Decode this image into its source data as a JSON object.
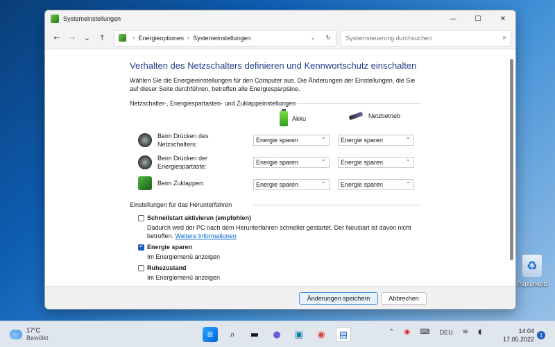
{
  "desktop": {
    "recycle_bin_label": "Papierkorb"
  },
  "window": {
    "title": "Systemeinstellungen",
    "controls": {
      "minimize": "—",
      "maximize": "☐",
      "close": "✕"
    }
  },
  "nav": {
    "back": "←",
    "forward": "→",
    "dropdown": "⌄",
    "up": "↑",
    "breadcrumb": [
      "Energieoptionen",
      "Systemeinstellungen"
    ],
    "breadcrumb_sep": "›",
    "addr_dropdown": "⌄",
    "refresh": "↻",
    "search_placeholder": "Systemsteuerung durchsuchen",
    "search_icon": "⌕"
  },
  "main": {
    "heading": "Verhalten des Netzschalters definieren und Kennwortschutz einschalten",
    "intro": "Wählen Sie die Energieeinstellungen für den Computer aus. Die Änderungen der Einstellungen, die Sie auf dieser Seite durchführen, betreffen alle Energiesparpläne.",
    "power_group_title": "Netzschalter-, Energiespartasten- und Zuklappeinstellungen",
    "col_battery": "Akku",
    "col_ac": "Netzbetrieb",
    "rows": [
      {
        "label": "Beim Drücken des Netzschalters:",
        "battery": "Energie sparen",
        "ac": "Energie sparen"
      },
      {
        "label": "Beim Drücken der Energiespartaste:",
        "battery": "Energie sparen",
        "ac": "Energie sparen"
      },
      {
        "label": "Beim Zuklappen:",
        "battery": "Energie sparen",
        "ac": "Energie sparen"
      }
    ],
    "shutdown_group_title": "Einstellungen für das Herunterfahren",
    "options": [
      {
        "label": "Schnellstart aktivieren (empfohlen)",
        "checked": false,
        "desc": "Dadurch wird der PC nach dem Herunterfahren schneller gestartet. Der Neustart ist davon nicht betroffen.",
        "link": "Weitere Informationen"
      },
      {
        "label": "Energie sparen",
        "checked": true,
        "desc": "Im Energiemenü anzeigen"
      },
      {
        "label": "Ruhezustand",
        "checked": false,
        "desc": "Im Energiemenü anzeigen"
      }
    ]
  },
  "footer": {
    "save": "Änderungen speichern",
    "cancel": "Abbrechen"
  },
  "taskbar": {
    "weather_temp": "17°C",
    "weather_desc": "Bewölkt",
    "language": "DEU",
    "time": "14:04",
    "date": "17.05.2022",
    "notification_count": "1",
    "tray_chevron": "⌃"
  },
  "colors": {
    "accent": "#1f5fbf",
    "heading": "#1e3d8a",
    "link": "#0066cc"
  }
}
